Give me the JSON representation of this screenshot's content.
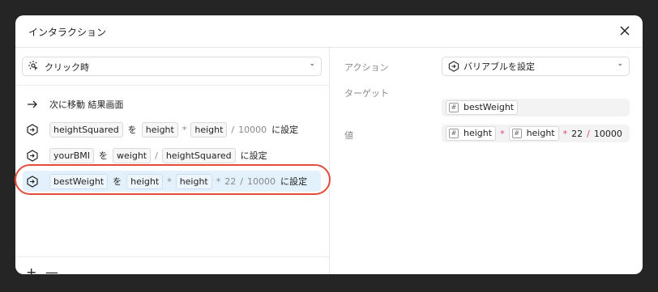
{
  "dialog": {
    "title": "インタラクション"
  },
  "trigger": {
    "label": "クリック時"
  },
  "actions": [
    {
      "kind": "navigate",
      "text": "次に移動 結果画面"
    },
    {
      "kind": "set",
      "target": "heightSquared",
      "wo": "を",
      "expr": [
        "height",
        "*",
        "height",
        "/",
        "10000"
      ],
      "suffix": "に設定"
    },
    {
      "kind": "set",
      "target": "yourBMI",
      "wo": "を",
      "expr": [
        "weight",
        "/",
        "heightSquared"
      ],
      "suffix": "に設定"
    },
    {
      "kind": "set",
      "target": "bestWeight",
      "wo": "を",
      "expr": [
        "height",
        "*",
        "height",
        "*",
        "22",
        "/",
        "10000"
      ],
      "suffix": "に設定"
    }
  ],
  "controls": {
    "add": "+",
    "remove": "—"
  },
  "properties": {
    "action_label": "アクション",
    "action_value": "バリアブルを設定",
    "target_label": "ターゲット",
    "target_value": "bestWeight",
    "value_label": "値",
    "value_expr": [
      "height",
      "*",
      "height",
      "*",
      "22",
      "/",
      "10000"
    ]
  },
  "colors": {
    "highlight_ring": "#e54b3b",
    "selected_row": "#e3f1fc",
    "operator_accent": "#e23b8d"
  }
}
